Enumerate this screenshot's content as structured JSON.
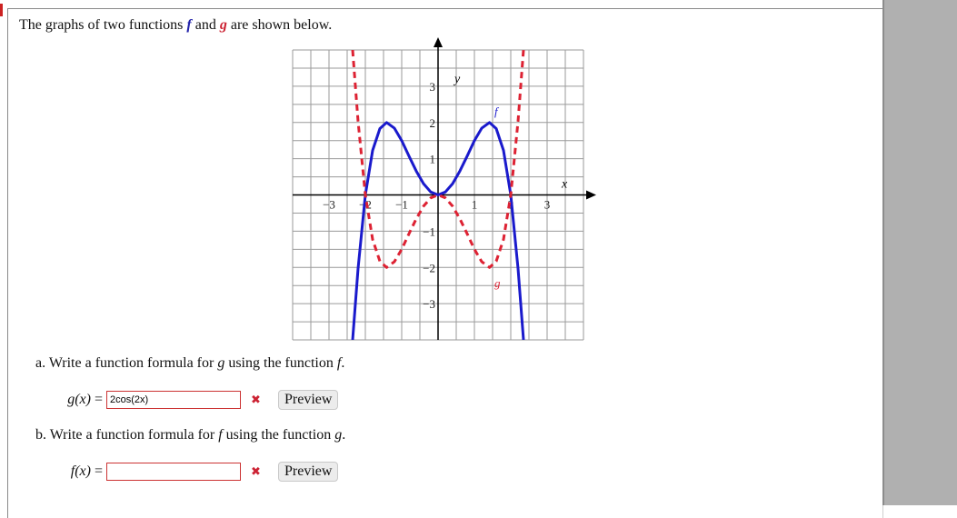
{
  "problem": {
    "intro_prefix": "The graphs of two functions ",
    "f_name": "f",
    "and_text": " and ",
    "g_name": "g",
    "intro_suffix": " are shown below."
  },
  "chart_data": {
    "type": "line",
    "title": "",
    "xlabel": "x",
    "ylabel": "y",
    "xlim": [
      -4,
      4
    ],
    "ylim": [
      -4,
      4
    ],
    "grid": true,
    "grid_step": 0.5,
    "x_ticks": [
      -3,
      -2,
      -1,
      1,
      2,
      3
    ],
    "x_tick_labels": [
      "−3",
      "−2",
      "−1",
      "1",
      "2",
      "3"
    ],
    "y_ticks": [
      3,
      2,
      1,
      -1,
      -2,
      -3
    ],
    "y_tick_labels": [
      "3",
      "2",
      "1",
      "−1",
      "−2",
      "−3"
    ],
    "series": [
      {
        "name": "f",
        "style": "solid",
        "color": "#1a1acc",
        "label_at": [
          1.55,
          2.2
        ],
        "x": [
          -2.35,
          -2.2,
          -2.0,
          -1.8,
          -1.6,
          -1.414,
          -1.2,
          -1.0,
          -0.8,
          -0.6,
          -0.4,
          -0.2,
          0,
          0.2,
          0.4,
          0.6,
          0.8,
          1.0,
          1.2,
          1.414,
          1.6,
          1.8,
          2.0,
          2.2,
          2.35
        ],
        "y": [
          -4.0,
          -2.03,
          0.0,
          1.23,
          1.83,
          2.0,
          1.84,
          1.5,
          1.07,
          0.66,
          0.31,
          0.08,
          0.0,
          0.08,
          0.31,
          0.66,
          1.07,
          1.5,
          1.84,
          2.0,
          1.83,
          1.23,
          0.0,
          -2.03,
          -4.0
        ]
      },
      {
        "name": "g",
        "style": "dashed",
        "color": "#dd2233",
        "label_at": [
          1.55,
          -2.55
        ],
        "x": [
          -2.35,
          -2.2,
          -2.0,
          -1.8,
          -1.6,
          -1.414,
          -1.2,
          -1.0,
          -0.8,
          -0.6,
          -0.4,
          -0.2,
          0,
          0.2,
          0.4,
          0.6,
          0.8,
          1.0,
          1.2,
          1.414,
          1.6,
          1.8,
          2.0,
          2.2,
          2.35
        ],
        "y": [
          4.0,
          2.03,
          0.0,
          -1.23,
          -1.83,
          -2.0,
          -1.84,
          -1.5,
          -1.07,
          -0.66,
          -0.31,
          -0.08,
          0.0,
          -0.08,
          -0.31,
          -0.66,
          -1.07,
          -1.5,
          -1.84,
          -2.0,
          -1.83,
          -1.23,
          0.0,
          2.03,
          4.0
        ]
      }
    ]
  },
  "part_a": {
    "label": "a.",
    "text_prefix": " Write a function formula for ",
    "var1": "g",
    "text_mid": " using the function ",
    "var2": "f",
    "text_suffix": ".",
    "lhs_fn": "g(x)",
    "lhs_eq": " = ",
    "input_value": "2cos(2x)",
    "status_icon": "✖",
    "preview_label": "Preview"
  },
  "part_b": {
    "label": "b.",
    "text_prefix": " Write a function formula for ",
    "var1": "f",
    "text_mid": " using the function ",
    "var2": "g",
    "text_suffix": ".",
    "lhs_fn": "f(x)",
    "lhs_eq": " = ",
    "input_value": "",
    "status_icon": "✖",
    "preview_label": "Preview"
  }
}
